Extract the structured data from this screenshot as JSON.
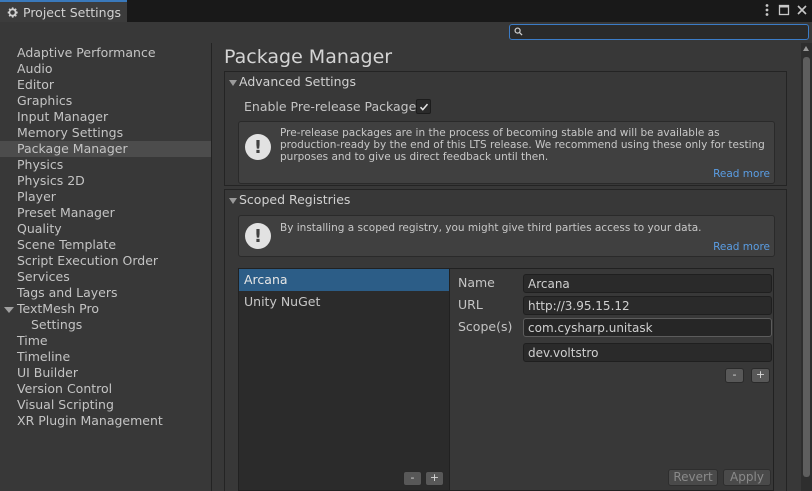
{
  "window": {
    "tab_title": "Project Settings",
    "icons": [
      "more-vertical-icon",
      "maximize-icon",
      "close-icon"
    ]
  },
  "search": {
    "value": "",
    "placeholder": ""
  },
  "sidebar": {
    "items": [
      {
        "label": "Adaptive Performance"
      },
      {
        "label": "Audio"
      },
      {
        "label": "Editor"
      },
      {
        "label": "Graphics"
      },
      {
        "label": "Input Manager"
      },
      {
        "label": "Memory Settings"
      },
      {
        "label": "Package Manager",
        "selected": true
      },
      {
        "label": "Physics"
      },
      {
        "label": "Physics 2D"
      },
      {
        "label": "Player"
      },
      {
        "label": "Preset Manager"
      },
      {
        "label": "Quality"
      },
      {
        "label": "Scene Template"
      },
      {
        "label": "Script Execution Order"
      },
      {
        "label": "Services"
      },
      {
        "label": "Tags and Layers"
      },
      {
        "label": "TextMesh Pro",
        "expanded": true
      },
      {
        "label": "Settings",
        "child": true
      },
      {
        "label": "Time"
      },
      {
        "label": "Timeline"
      },
      {
        "label": "UI Builder"
      },
      {
        "label": "Version Control"
      },
      {
        "label": "Visual Scripting"
      },
      {
        "label": "XR Plugin Management"
      }
    ]
  },
  "main": {
    "title": "Package Manager",
    "advanced": {
      "header": "Advanced Settings",
      "toggle_label": "Enable Pre-release Packages",
      "toggle_checked": true,
      "help_text": "Pre-release packages are in the process of becoming stable and will be available as production-ready by the end of this LTS release. We recommend using these only for testing purposes and to give us direct feedback until then.",
      "read_more": "Read more"
    },
    "scoped": {
      "header": "Scoped Registries",
      "help_text": "By installing a scoped registry, you might give third parties access to your data.",
      "read_more": "Read more",
      "registries": [
        {
          "label": "Arcana",
          "selected": true
        },
        {
          "label": "Unity NuGet"
        }
      ],
      "minus": "-",
      "plus": "+",
      "name_label": "Name",
      "name_value": "Arcana",
      "url_label": "URL",
      "url_value": "http://3.95.15.12",
      "scopes_label": "Scope(s)",
      "scopes": [
        "com.cysharp.unitask",
        "dev.voltstro"
      ],
      "revert": "Revert",
      "apply": "Apply"
    }
  },
  "colors": {
    "accent": "#3a79bb",
    "selection": "#2c5d87",
    "link": "#5a9de3",
    "background": "#383838"
  }
}
